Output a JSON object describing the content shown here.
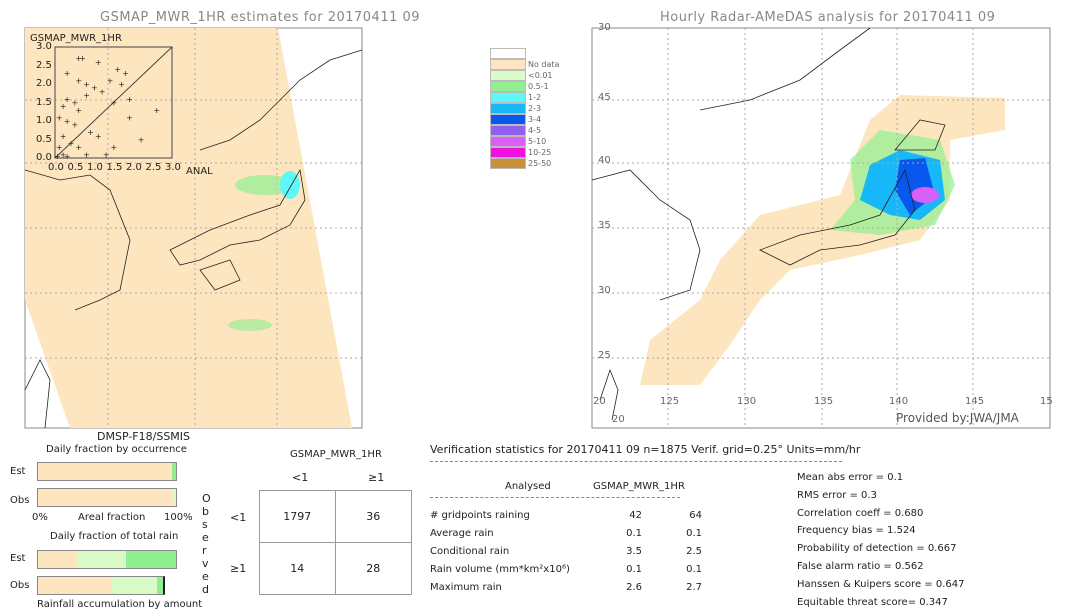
{
  "left_map": {
    "title": "GSMAP_MWR_1HR estimates for 20170411 09",
    "sensor": "DMSP-F18/SSMIS",
    "scatter": {
      "ylabel": "GSMAP_MWR_1HR",
      "xlabel": "ANAL",
      "ticks": [
        "0.0",
        "0.5",
        "1.0",
        "1.5",
        "2.0",
        "2.5",
        "3.0"
      ],
      "range": [
        0,
        3
      ],
      "points": [
        [
          0.6,
          2.7
        ],
        [
          0.7,
          2.7
        ],
        [
          1.1,
          2.6
        ],
        [
          0.3,
          2.3
        ],
        [
          1.6,
          2.4
        ],
        [
          1.8,
          2.3
        ],
        [
          0.6,
          2.1
        ],
        [
          0.8,
          2.0
        ],
        [
          1.0,
          1.9
        ],
        [
          1.4,
          2.1
        ],
        [
          1.7,
          2.0
        ],
        [
          1.2,
          1.8
        ],
        [
          0.8,
          1.7
        ],
        [
          0.3,
          1.6
        ],
        [
          0.5,
          1.5
        ],
        [
          0.2,
          1.4
        ],
        [
          0.6,
          1.3
        ],
        [
          1.5,
          1.5
        ],
        [
          1.9,
          1.6
        ],
        [
          0.1,
          1.1
        ],
        [
          0.3,
          1.0
        ],
        [
          0.5,
          0.9
        ],
        [
          0.9,
          0.7
        ],
        [
          1.1,
          0.6
        ],
        [
          1.9,
          1.1
        ],
        [
          2.6,
          1.3
        ],
        [
          0.2,
          0.6
        ],
        [
          0.4,
          0.4
        ],
        [
          0.6,
          0.3
        ],
        [
          1.5,
          0.3
        ],
        [
          2.2,
          0.5
        ],
        [
          0.1,
          0.3
        ],
        [
          0.2,
          0.1
        ],
        [
          0.05,
          0.05
        ],
        [
          0.3,
          0.05
        ],
        [
          0.8,
          0.1
        ],
        [
          1.3,
          0.1
        ]
      ]
    }
  },
  "right_map": {
    "title": "Hourly Radar-AMeDAS analysis for 20170411 09",
    "credit": "Provided by:JWA/JMA",
    "lat_labels": [
      "45",
      "40",
      "35",
      "30",
      "25"
    ],
    "lon_labels": [
      "20",
      "125",
      "130",
      "135",
      "140",
      "145",
      "15"
    ],
    "top_label": "30",
    "bottom_label": "20"
  },
  "legend": [
    {
      "label": "",
      "color": "#ffffff"
    },
    {
      "label": "No data",
      "color": "#fde6bf"
    },
    {
      "label": "<0.01",
      "color": "#d8fbc8"
    },
    {
      "label": "0.5-1",
      "color": "#90ef90"
    },
    {
      "label": "1-2",
      "color": "#5ff8f8"
    },
    {
      "label": "2-3",
      "color": "#18b8f8"
    },
    {
      "label": "3-4",
      "color": "#0858f0"
    },
    {
      "label": "4-5",
      "color": "#9060f0"
    },
    {
      "label": "5-10",
      "color": "#d860f8"
    },
    {
      "label": "10-25",
      "color": "#f010e0"
    },
    {
      "label": "25-50",
      "color": "#c89038"
    }
  ],
  "fractions": {
    "occurrence_title": "Daily fraction by occurrence",
    "est": "Est",
    "obs": "Obs",
    "axis_left": "0%",
    "axis_mid": "Areal fraction",
    "axis_right": "100%",
    "rain_title": "Daily fraction of total rain",
    "accum_label": "Rainfall accumulation by amount",
    "occ_est": [
      0.97,
      0.03
    ],
    "occ_obs": [
      0.98,
      0.02
    ],
    "rain_est": [
      0.28,
      0.36,
      0.36
    ],
    "rain_obs": [
      0.54,
      0.33,
      0.04
    ]
  },
  "contingency": {
    "title": "GSMAP_MWR_1HR",
    "col_lt": "<1",
    "col_ge": "≥1",
    "row_label": "Observed",
    "row_lt": "<1",
    "row_ge": "≥1",
    "cells": [
      [
        "1797",
        "36"
      ],
      [
        "14",
        "28"
      ]
    ]
  },
  "stats": {
    "header": "Verification statistics for 20170411 09   n=1875   Verif. grid=0.25°   Units=mm/hr",
    "col1": "Analysed",
    "col2": "GSMAP_MWR_1HR",
    "rows": [
      {
        "label": "# gridpoints raining",
        "a": "42",
        "b": "64"
      },
      {
        "label": "Average rain",
        "a": "0.1",
        "b": "0.1"
      },
      {
        "label": "Conditional rain",
        "a": "3.5",
        "b": "2.5"
      },
      {
        "label": "Rain volume (mm*km²x10⁶)",
        "a": "0.1",
        "b": "0.1"
      },
      {
        "label": "Maximum rain",
        "a": "2.6",
        "b": "2.7"
      }
    ],
    "scores": [
      "Mean abs error = 0.1",
      "RMS error = 0.3",
      "Correlation coeff = 0.680",
      "Frequency bias = 1.524",
      "Probability of detection = 0.667",
      "False alarm ratio = 0.562",
      "Hanssen & Kuipers score = 0.647",
      "Equitable threat score= 0.347"
    ]
  }
}
